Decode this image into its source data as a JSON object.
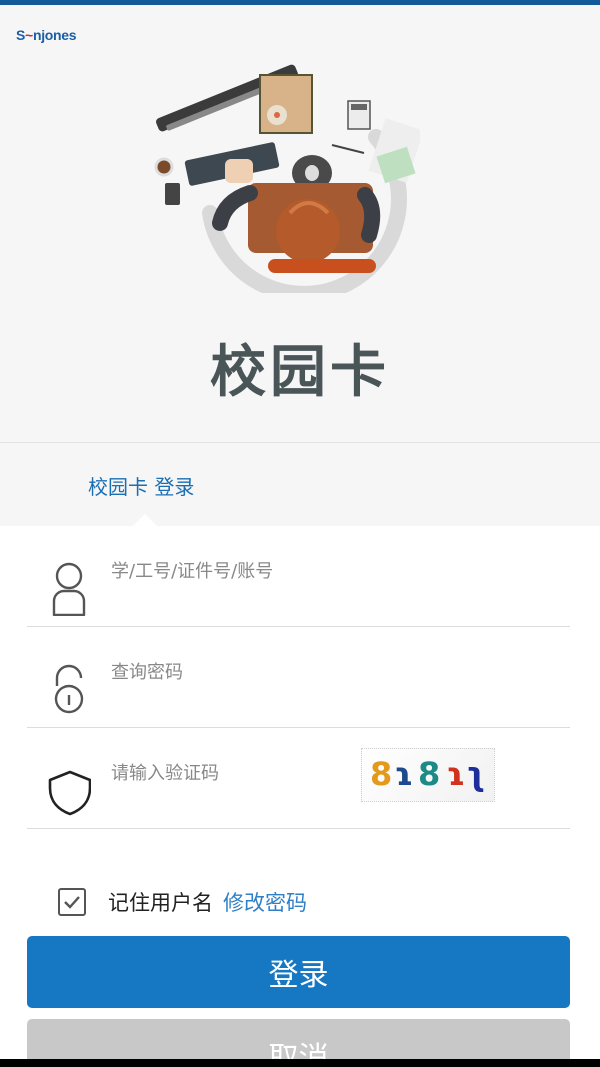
{
  "brand": {
    "logo_prefix": "S",
    "logo_accent": "~",
    "logo_suffix": "njones"
  },
  "app_title": "校园卡",
  "login_tab": {
    "label": "校园卡 登录"
  },
  "form": {
    "username": {
      "placeholder": "学/工号/证件号/账号",
      "value": ""
    },
    "password": {
      "placeholder": "查询密码",
      "value": ""
    },
    "captcha": {
      "placeholder": "请输入验证码",
      "value": "",
      "image_text": [
        "8",
        "ɿ",
        "8",
        "ɿ",
        "ʅ"
      ]
    },
    "remember_label": "记住用户名",
    "remember_checked": false,
    "change_password_link": "修改密码"
  },
  "buttons": {
    "login": "登录",
    "cancel": "取消"
  },
  "icons": {
    "username": "user-icon",
    "password": "lock-icon",
    "captcha": "shield-icon"
  },
  "colors": {
    "primary": "#1677c2",
    "tab_text": "#1a6fb3",
    "link": "#2f7fc6",
    "cancel_bg": "#c8c8c8",
    "header_bar": "#135a9b"
  }
}
